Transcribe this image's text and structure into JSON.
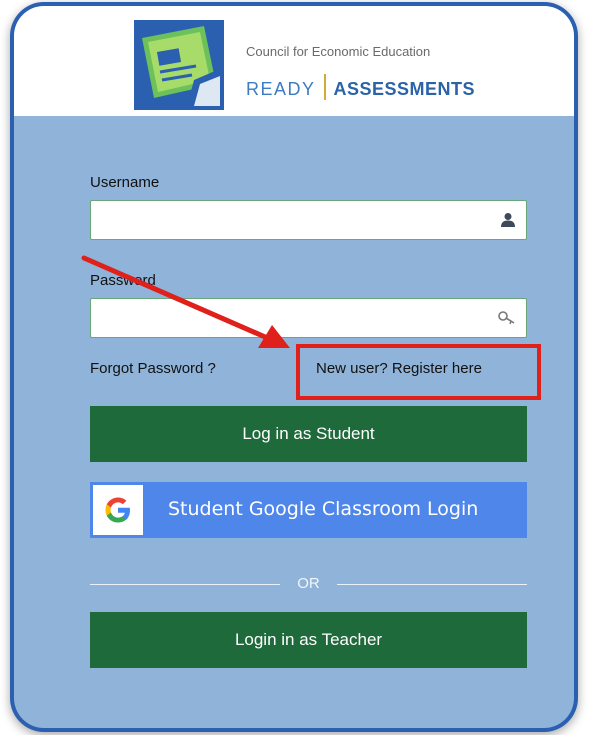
{
  "header": {
    "org_name": "Council for Economic Education",
    "brand_ready": "READY",
    "brand_assessments": "ASSESSMENTS"
  },
  "form": {
    "username_label": "Username",
    "username_value": "",
    "password_label": "Password",
    "password_value": "",
    "forgot_password": "Forgot Password ?",
    "register_link": "New user? Register here",
    "student_login": "Log in as Student",
    "google_login": "Student Google Classroom Login",
    "or_text": "OR",
    "teacher_login": "Login in as Teacher"
  },
  "icons": {
    "logo": "classroom-board-logo",
    "username": "user-icon",
    "password": "key-icon",
    "google": "google-g-icon",
    "annotation_arrow": "red-arrow",
    "annotation_box": "red-highlight-box"
  },
  "colors": {
    "panel_bg": "#8fb3d9",
    "primary_button": "#1e6a3a",
    "google_button": "#4f86ea",
    "brand_blue": "#2a63a8",
    "annotation_red": "#e0201a"
  }
}
